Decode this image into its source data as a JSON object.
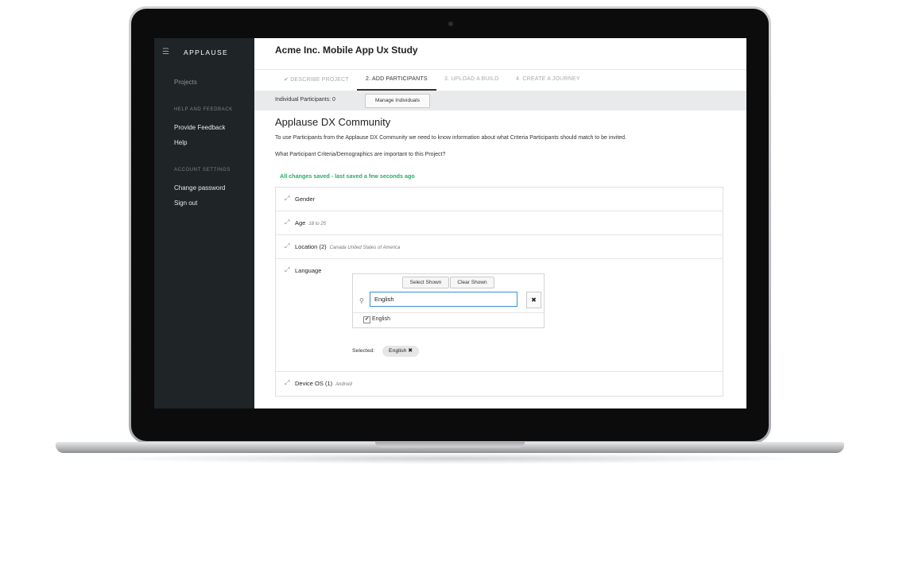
{
  "sidebar": {
    "brand": "APPLAUSE",
    "menu_icon": "hamburger-icon",
    "items": [
      {
        "label": "Projects"
      },
      {
        "label": "HELP AND FEEDBACK"
      },
      {
        "label": "Provide Feedback"
      },
      {
        "label": "Help"
      },
      {
        "label": "ACCOUNT SETTINGS"
      },
      {
        "label": "Change password"
      },
      {
        "label": "Sign out"
      }
    ]
  },
  "header": {
    "title": "Acme Inc. Mobile App Ux Study"
  },
  "tabs": [
    {
      "label": "✔ DESCRIBE PROJECT"
    },
    {
      "label": "2. ADD PARTICIPANTS"
    },
    {
      "label": "3. UPLOAD A BUILD"
    },
    {
      "label": "4. CREATE A JOURNEY"
    }
  ],
  "bar": {
    "participants": "Individual Participants: 0",
    "manage_label": "Manage Individuals"
  },
  "community": {
    "heading": "Applause DX Community",
    "intro": "To use Participants from the Applause DX Community we need to know information about what Criteria Participants should match to be invited.",
    "question": "What Participant Criteria/Demographics are important to this Project?",
    "saved_status": "All changes saved - last saved a few seconds ago"
  },
  "criteria": {
    "gender": {
      "label": "Gender"
    },
    "age": {
      "label": "Age",
      "sub": "18 to 25"
    },
    "location": {
      "label": "Location",
      "count": "(2)",
      "sub": "Canada  United States of America"
    },
    "language": {
      "label": "Language",
      "select_shown": "Select Shown",
      "clear_shown": "Clear Shown",
      "search_value": "English",
      "option_label": "English",
      "option_checked": "✔",
      "selected_label": "Selected:",
      "chip_label": "English",
      "chip_remove": "✖"
    },
    "device_os": {
      "label": "Device OS",
      "count": "(1)",
      "sub": "Android"
    }
  },
  "colors": {
    "sidebar_bg": "#1f2426",
    "accent_blue": "#3d8fd0",
    "saved_green": "#27ae60"
  }
}
